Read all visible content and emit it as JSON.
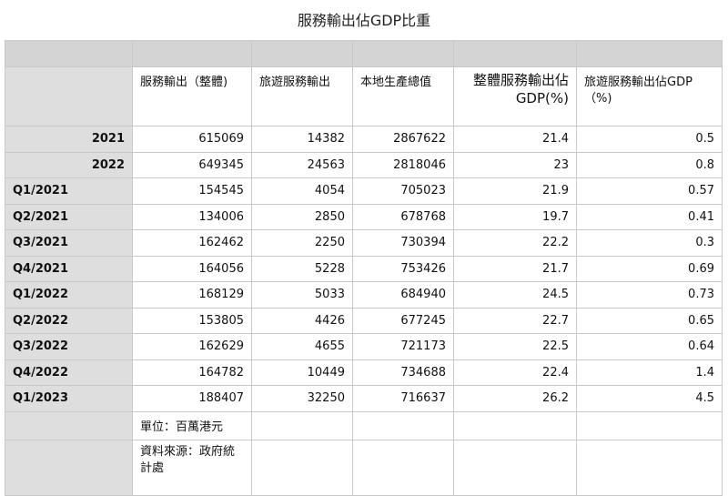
{
  "title": "服務輸出佔GDP比重",
  "headers": [
    "服務輸出（整體)",
    "旅遊服務輸出",
    "本地生產總值",
    "整體服務輸出佔GDP(%)",
    "旅遊服務輸出佔GDP（%)"
  ],
  "rows": [
    {
      "label": "2021",
      "values": [
        "615069",
        "14382",
        "2867622",
        "21.4",
        "0.5"
      ]
    },
    {
      "label": "2022",
      "values": [
        "649345",
        "24563",
        "2818046",
        "23",
        "0.8"
      ]
    },
    {
      "label": "Q1/2021",
      "values": [
        "154545",
        "4054",
        "705023",
        "21.9",
        "0.57"
      ]
    },
    {
      "label": "Q2/2021",
      "values": [
        "134006",
        "2850",
        "678768",
        "19.7",
        "0.41"
      ]
    },
    {
      "label": "Q3/2021",
      "values": [
        "162462",
        "2250",
        "730394",
        "22.2",
        "0.3"
      ]
    },
    {
      "label": "Q4/2021",
      "values": [
        "164056",
        "5228",
        "753426",
        "21.7",
        "0.69"
      ]
    },
    {
      "label": "Q1/2022",
      "values": [
        "168129",
        "5033",
        "684940",
        "24.5",
        "0.73"
      ]
    },
    {
      "label": "Q2/2022",
      "values": [
        "153805",
        "4426",
        "677245",
        "22.7",
        "0.65"
      ]
    },
    {
      "label": "Q3/2022",
      "values": [
        "162629",
        "4655",
        "721173",
        "22.5",
        "0.64"
      ]
    },
    {
      "label": "Q4/2022",
      "values": [
        "164782",
        "10449",
        "734688",
        "22.4",
        "1.4"
      ]
    },
    {
      "label": "Q1/2023",
      "values": [
        "188407",
        "32250",
        "716637",
        "26.2",
        "4.5"
      ]
    }
  ],
  "notes": {
    "unit": "單位：百萬港元",
    "source": "資料來源：政府統計處"
  },
  "colors": {
    "header_bar": "#d4d4d4",
    "label_column": "#dedede",
    "grid": "#c8c8c8"
  }
}
